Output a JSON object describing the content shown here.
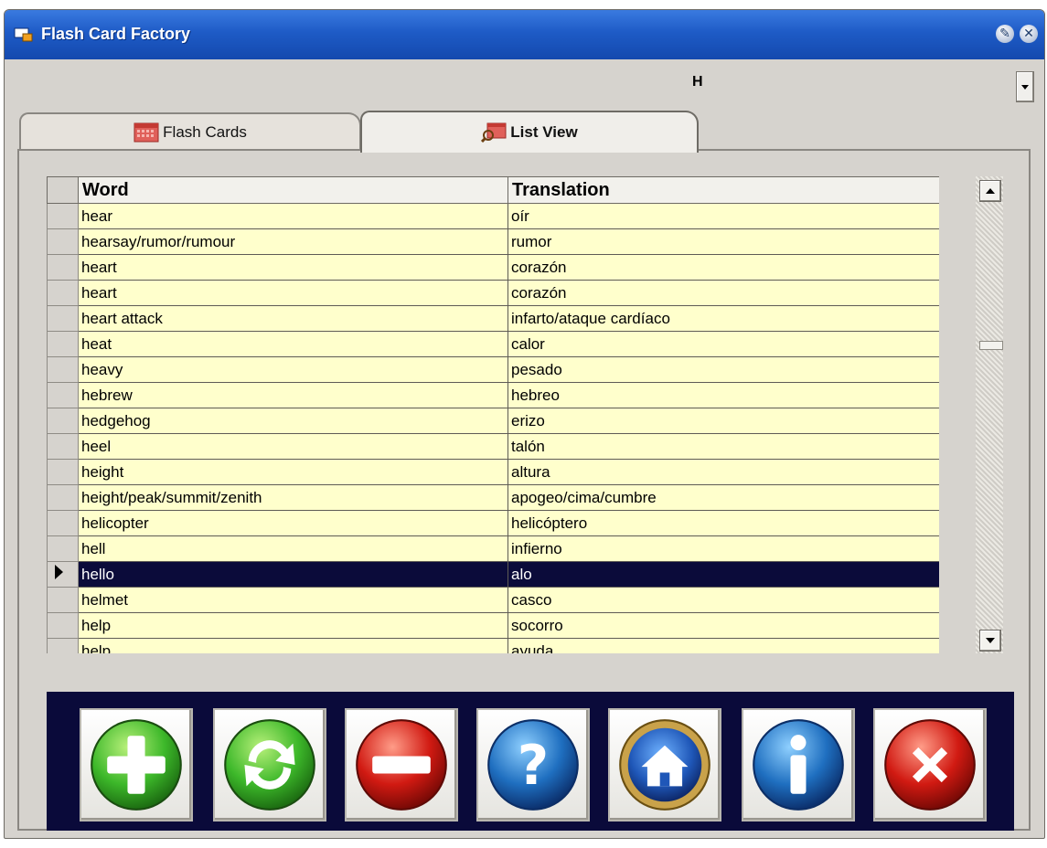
{
  "window": {
    "title": "Flash Card Factory"
  },
  "letter_select": {
    "value": "H"
  },
  "tabs": [
    {
      "label": "Flash Cards",
      "active": false
    },
    {
      "label": "List View",
      "active": true
    }
  ],
  "grid": {
    "columns": [
      "Word",
      "Translation"
    ],
    "selected_index": 14,
    "rows": [
      {
        "word": "hear",
        "translation": "oír"
      },
      {
        "word": "hearsay/rumor/rumour",
        "translation": "rumor"
      },
      {
        "word": "heart",
        "translation": "corazón"
      },
      {
        "word": "heart",
        "translation": "corazón"
      },
      {
        "word": "heart attack",
        "translation": "infarto/ataque cardíaco"
      },
      {
        "word": "heat",
        "translation": "calor"
      },
      {
        "word": "heavy",
        "translation": "pesado"
      },
      {
        "word": "hebrew",
        "translation": "hebreo"
      },
      {
        "word": "hedgehog",
        "translation": "erizo"
      },
      {
        "word": "heel",
        "translation": "talón"
      },
      {
        "word": "height",
        "translation": "altura"
      },
      {
        "word": "height/peak/summit/zenith",
        "translation": "apogeo/cima/cumbre"
      },
      {
        "word": "helicopter",
        "translation": "helicóptero"
      },
      {
        "word": "hell",
        "translation": "infierno"
      },
      {
        "word": "hello",
        "translation": "alo"
      },
      {
        "word": "helmet",
        "translation": "casco"
      },
      {
        "word": "help",
        "translation": "socorro"
      },
      {
        "word": "help",
        "translation": "ayuda"
      }
    ]
  },
  "toolbar": {
    "buttons": [
      {
        "name": "add-button",
        "icon": "plus-icon",
        "color": "#3db82a"
      },
      {
        "name": "refresh-button",
        "icon": "refresh-icon",
        "color": "#3db82a"
      },
      {
        "name": "remove-button",
        "icon": "minus-icon",
        "color": "#d11a12"
      },
      {
        "name": "help-button",
        "icon": "question-icon",
        "color": "#1f6fc0"
      },
      {
        "name": "home-button",
        "icon": "home-icon",
        "color": "#1f57b8"
      },
      {
        "name": "info-button",
        "icon": "info-icon",
        "color": "#1f6fc0"
      },
      {
        "name": "close-button",
        "icon": "close-x-icon",
        "color": "#d11a12"
      }
    ]
  },
  "colors": {
    "titlebar": "#1e5bc6",
    "grid_row_bg": "#ffffcc",
    "selection_bg": "#0b0b3a",
    "toolbar_bg": "#0a0a3a"
  }
}
